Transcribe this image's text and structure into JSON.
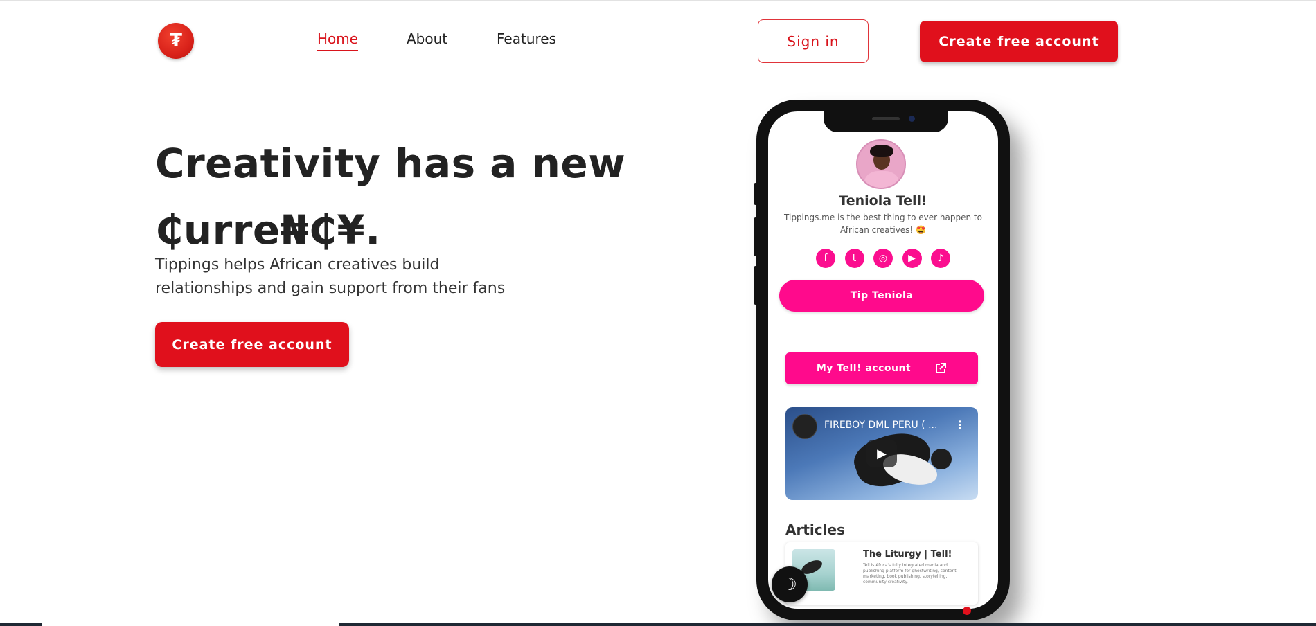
{
  "header": {
    "logo_icon": "tippings-logo-icon",
    "logo_glyph": "₮",
    "nav": [
      {
        "label": "Home",
        "active": true
      },
      {
        "label": "About",
        "active": false
      },
      {
        "label": "Features",
        "active": false
      }
    ],
    "signin_label": "Sign in",
    "create_account_label": "Create free account"
  },
  "hero": {
    "title_line1": "Creativity has a new",
    "title_line2": "₵urre₦₵¥.",
    "subtitle": "Tippings helps African creatives build relationships and gain support from their fans",
    "cta_label": "Create free account"
  },
  "phone": {
    "profile_name": "Teniola Tell!",
    "bio": "Tippings.me is the best thing to ever happen to African creatives! 🤩",
    "socials": [
      {
        "icon": "facebook-icon",
        "glyph": "f"
      },
      {
        "icon": "twitter-icon",
        "glyph": "t"
      },
      {
        "icon": "instagram-icon",
        "glyph": "◎"
      },
      {
        "icon": "youtube-icon",
        "glyph": "▶"
      },
      {
        "icon": "tiktok-icon",
        "glyph": "♪"
      }
    ],
    "tip_label": "Tip Teniola",
    "account_link_label": "My Tell! account",
    "video_title": "FIREBOY DML PERU ( ...",
    "video_menu": "⋮",
    "video_play": "▶",
    "articles_heading": "Articles",
    "article": {
      "title": "The Liturgy | Tell!",
      "description": "Tell is Africa's fully integrated media and publishing platform for ghostwriting, content marketing, book publishing, storytelling, community creativity."
    }
  },
  "theme_toggle_glyph": "☽",
  "colors": {
    "brand_red": "#e0101c",
    "accent_pink": "#ff0a8c",
    "text_dark": "#222222"
  }
}
